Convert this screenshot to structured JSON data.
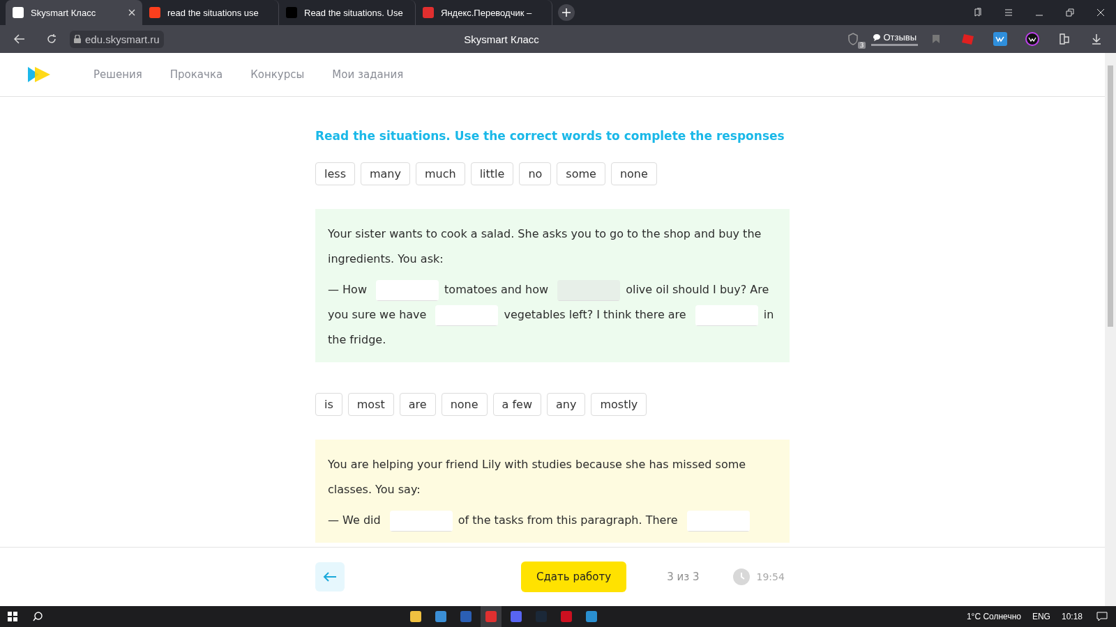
{
  "browser": {
    "tabs": [
      {
        "title": "Skysmart Класс",
        "selected": true
      },
      {
        "title": "read the situations use",
        "selected": false
      },
      {
        "title": "Read the situations. Use",
        "selected": false
      },
      {
        "title": "Яндекс.Переводчик –",
        "selected": false
      }
    ],
    "address": "edu.skysmart.ru",
    "page_title": "Skysmart Класс",
    "shield_count": "3",
    "reviews": "Отзывы"
  },
  "nav": {
    "items": [
      "Решения",
      "Прокачка",
      "Конкурсы",
      "Мои задания"
    ]
  },
  "task": {
    "title": "Read the situations. Use the correct words to complete the responses",
    "blocks": [
      {
        "kind": "exercise",
        "words": [
          "less",
          "many",
          "much",
          "little",
          "no",
          "some",
          "none"
        ],
        "situation": "Your sister wants to cook a salad. She asks you to go to the shop and buy the ingredients. You ask:",
        "response": [
          {
            "kind": "text",
            "text": "— How"
          },
          {
            "kind": "blank"
          },
          {
            "kind": "text",
            "text": "tomatoes and how"
          },
          {
            "kind": "blank",
            "disabled": true
          },
          {
            "kind": "text",
            "text": "olive oil should I buy? Are"
          },
          {
            "kind": "text",
            "text": "you sure we have"
          },
          {
            "kind": "blank"
          },
          {
            "kind": "text",
            "text": "vegetables left? I think there are"
          },
          {
            "kind": "blank"
          },
          {
            "kind": "text",
            "text": "in"
          },
          {
            "kind": "text",
            "text": "the fridge."
          }
        ]
      },
      {
        "kind": "exercise",
        "words": [
          "is",
          "most",
          "are",
          "none",
          "a few",
          "any",
          "mostly"
        ],
        "situation": "You are helping your friend Lily with studies because she has missed some classes. You say:",
        "response": [
          {
            "kind": "text",
            "text": "— We did"
          },
          {
            "kind": "blank"
          },
          {
            "kind": "text",
            "text": "of the tasks from this paragraph. There"
          },
          {
            "kind": "blank"
          }
        ]
      }
    ]
  },
  "footer": {
    "submit": "Сдать работу",
    "progress": "3 из 3",
    "timer": "19:54"
  },
  "taskbar": {
    "weather": "1°C  Солнечно",
    "language": "ENG",
    "time": "10:18"
  }
}
